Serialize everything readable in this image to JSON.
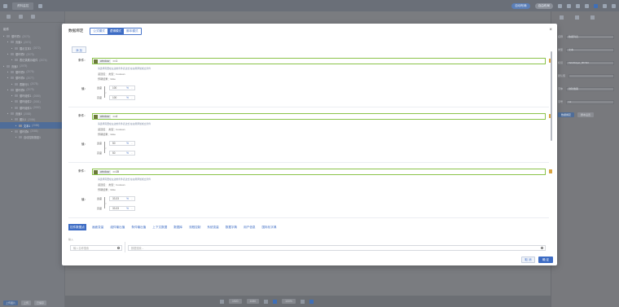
{
  "topbar": {
    "tab": "资料监控",
    "pill_on": "自动布局",
    "pill_off": "自由布局"
  },
  "leftbar": {
    "section": "组件",
    "tree": [
      {
        "label": "循环项1",
        "count": "(2070)",
        "depth": 0,
        "selected": false
      },
      {
        "label": "页面1",
        "count": "(2071)",
        "depth": 1,
        "selected": false
      },
      {
        "label": "展示文本1",
        "count": "(2072)",
        "depth": 2,
        "selected": false
      },
      {
        "label": "循环项2",
        "count": "(2073)",
        "depth": 1,
        "selected": false
      },
      {
        "label": "表记录展示组件",
        "count": "(2074)",
        "depth": 2,
        "selected": false
      },
      {
        "label": "页面2",
        "count": "(2075)",
        "depth": 0,
        "selected": false
      },
      {
        "label": "循环项3",
        "count": "(2076)",
        "depth": 1,
        "selected": false
      },
      {
        "label": "循环项4",
        "count": "(2077)",
        "depth": 1,
        "selected": false
      },
      {
        "label": "表格行1",
        "count": "(2078)",
        "depth": 2,
        "selected": false
      },
      {
        "label": "循环项5",
        "count": "(2079)",
        "depth": 1,
        "selected": false
      },
      {
        "label": "循环组件1",
        "count": "(2080)",
        "depth": 2,
        "selected": false
      },
      {
        "label": "循环组件2",
        "count": "(2081)",
        "depth": 2,
        "selected": false
      },
      {
        "label": "循环组件3",
        "count": "(2082)",
        "depth": 2,
        "selected": false
      },
      {
        "label": "页面3",
        "count": "(2083)",
        "depth": 1,
        "selected": false
      },
      {
        "label": "图片1",
        "count": "(2084)",
        "depth": 2,
        "selected": false
      },
      {
        "label": "文本1",
        "count": "(2085)",
        "depth": 3,
        "selected": true
      },
      {
        "label": "循环项6",
        "count": "(2086)",
        "depth": 2,
        "selected": false
      },
      {
        "label": "自动控制按钮1",
        "count": "",
        "depth": 3,
        "selected": false
      }
    ],
    "bottom": [
      "上传图片",
      "上传",
      "已保存"
    ]
  },
  "statusbar": {
    "zoom": "1920",
    "h": "1080",
    "pct": "100%"
  },
  "rightbar": {
    "rows": [
      {
        "label": "名称",
        "value": "数据列表"
      },
      {
        "label": "类型",
        "value": "文本"
      },
      {
        "label": "标识",
        "value": "TabWidget_ffff7f00"
      },
      {
        "label": "默认值",
        "value": ""
      },
      {
        "label": "字体",
        "value": "微软雅黑"
      },
      {
        "label": "字号",
        "value": "12"
      }
    ],
    "buttons": [
      "数据绑定",
      "脚本设置"
    ]
  },
  "modal": {
    "title": "数据绑定",
    "modes": [
      "公式模式",
      "逻辑模式",
      "脚本模式"
    ],
    "active_mode": 1,
    "add_label": "添 加",
    "conditions": [
      {
        "label": "条件：",
        "expr_token": "window",
        "expr_rest": "==1",
        "hint": "请选择需要在左边的条件表达式,在右侧添加成立条件",
        "type_line": "返回值：    类型：boolean",
        "pre_line": "预期结果：false",
        "value_label": "值：",
        "k1": "宽度",
        "k2": "高度",
        "mid": "<",
        "v1": "100",
        "v2": "100",
        "unit": "%"
      },
      {
        "label": "条件：",
        "expr_token": "window",
        "expr_rest": "==4",
        "hint": "请选择需要在左边的条件表达式,在右侧添加成立条件",
        "type_line": "返回值：    类型：boolean",
        "pre_line": "预期结果：false",
        "value_label": "值：",
        "k1": "宽度",
        "k2": "高度",
        "mid": "<",
        "v1": "50",
        "v2": "50",
        "unit": "%"
      },
      {
        "label": "条件：",
        "expr_token": "window",
        "expr_rest": "==15",
        "hint": "请选择需要在左边的条件表达式,在右侧添加成立条件",
        "type_line": "返回值：    类型：boolean",
        "pre_line": "预期结果：false",
        "value_label": "值：",
        "k1": "宽度",
        "k2": "高度",
        "mid": "<",
        "v1": "33.33",
        "v2": "33.33",
        "unit": "%"
      }
    ],
    "tabs": [
      "控件数据点",
      "画面变量",
      "组件输出值",
      "条件输出值",
      "上下文数据",
      "数据库",
      "流程控制",
      "系统变量",
      "数据字典",
      "用户信息",
      "国际化字典"
    ],
    "active_tab": 0,
    "mini_label": "输入",
    "search_left_placeholder": "输入名称搜索",
    "search_right_placeholder": "数据搜索...",
    "cancel": "取 消",
    "ok": "确 定"
  }
}
